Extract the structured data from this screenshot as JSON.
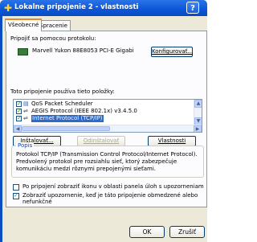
{
  "window": {
    "title": "Lokalne pripojenie 2 - vlastnosti",
    "help_label": "?",
    "title_icon": "network-connection-icon"
  },
  "tabs": [
    {
      "label": "Všeobecné",
      "active": true
    },
    {
      "label": "Spracenie",
      "active": false
    }
  ],
  "connect_using": {
    "label": "Pripojiť sa pomocou protokolu:",
    "device_name": "Marvell Yukon 88E8053 PCI-E Gigabi",
    "configure_label": "Konfigurovať..."
  },
  "components": {
    "label": "Toto pripojenie používa tieto položky:",
    "items": [
      {
        "label": "QoS Packet Scheduler",
        "checked": true,
        "selected": false
      },
      {
        "label": "AEGIS Protocol (IEEE 802.1x) v3.4.5.0",
        "checked": true,
        "selected": false
      },
      {
        "label": "Internet Protocol (TCP/IP)",
        "checked": true,
        "selected": true
      }
    ]
  },
  "actions": {
    "install_label": "Inštalovať...",
    "uninstall_label": "Odinštalovať",
    "properties_label": "Vlastnosti"
  },
  "description": {
    "title": "Popis",
    "text": "Protokol TCP/IP (Transmission Control Protocol/Internet Protocol). Predvolený protokol pre rozsiahlu sieť, ktorý zabezpečuje komunikáciu medzi rôznymi prepojenými sieťami."
  },
  "options": {
    "show_icon_label": "Po pripojení zobraziť ikonu v oblasti panela úloh s upozorneniami",
    "show_icon_checked": false,
    "notify_label": "Zobraziť upozornenie, keď je táto pripojenie obmedzené alebo nefunkčné",
    "notify_checked": true
  },
  "dialog_buttons": {
    "ok_label": "OK",
    "cancel_label": "Zrušiť"
  },
  "colors": {
    "titlebar": "#0b56d6",
    "selection": "#316ac5",
    "group_title": "#0046d5"
  }
}
